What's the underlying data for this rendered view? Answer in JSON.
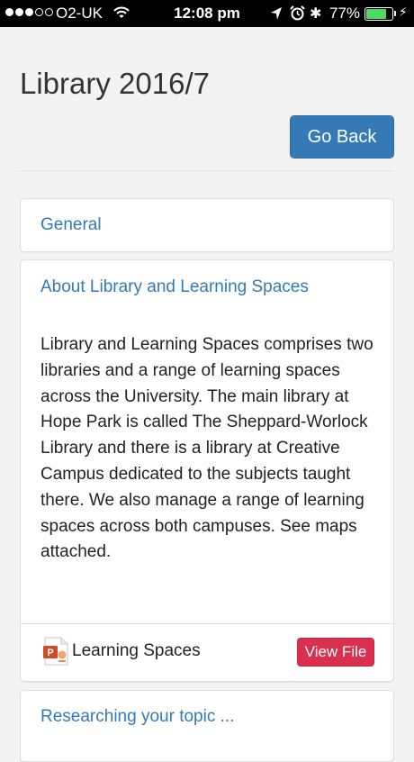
{
  "status_bar": {
    "carrier": "O2-UK",
    "time": "12:08 pm",
    "battery_percent": "77%",
    "battery_level": 0.77,
    "signal_strength": 3,
    "icons": [
      "wifi-icon",
      "location-arrow-icon",
      "alarm-icon",
      "bluetooth-icon",
      "battery-icon",
      "charging-icon"
    ]
  },
  "page": {
    "title": "Library 2016/7",
    "back_label": "Go Back"
  },
  "sections": {
    "general": {
      "title": "General"
    },
    "about": {
      "title": "About Library and Learning Spaces",
      "body": "Library and Learning Spaces comprises two libraries and a range of learning spaces across the University. The main library at Hope Park is called The Sheppard-Worlock Library and there is a library at Creative Campus dedicated to the subjects taught there. We also manage a range of learning spaces across both campuses. See maps attached.",
      "attachment": {
        "icon": "powerpoint-file-icon",
        "name": "Learning Spaces",
        "action_label": "View File"
      }
    },
    "researching": {
      "title": "Researching your topic ..."
    }
  },
  "colors": {
    "primary": "#337ab7",
    "danger": "#d9304f",
    "battery": "#4cd964"
  }
}
